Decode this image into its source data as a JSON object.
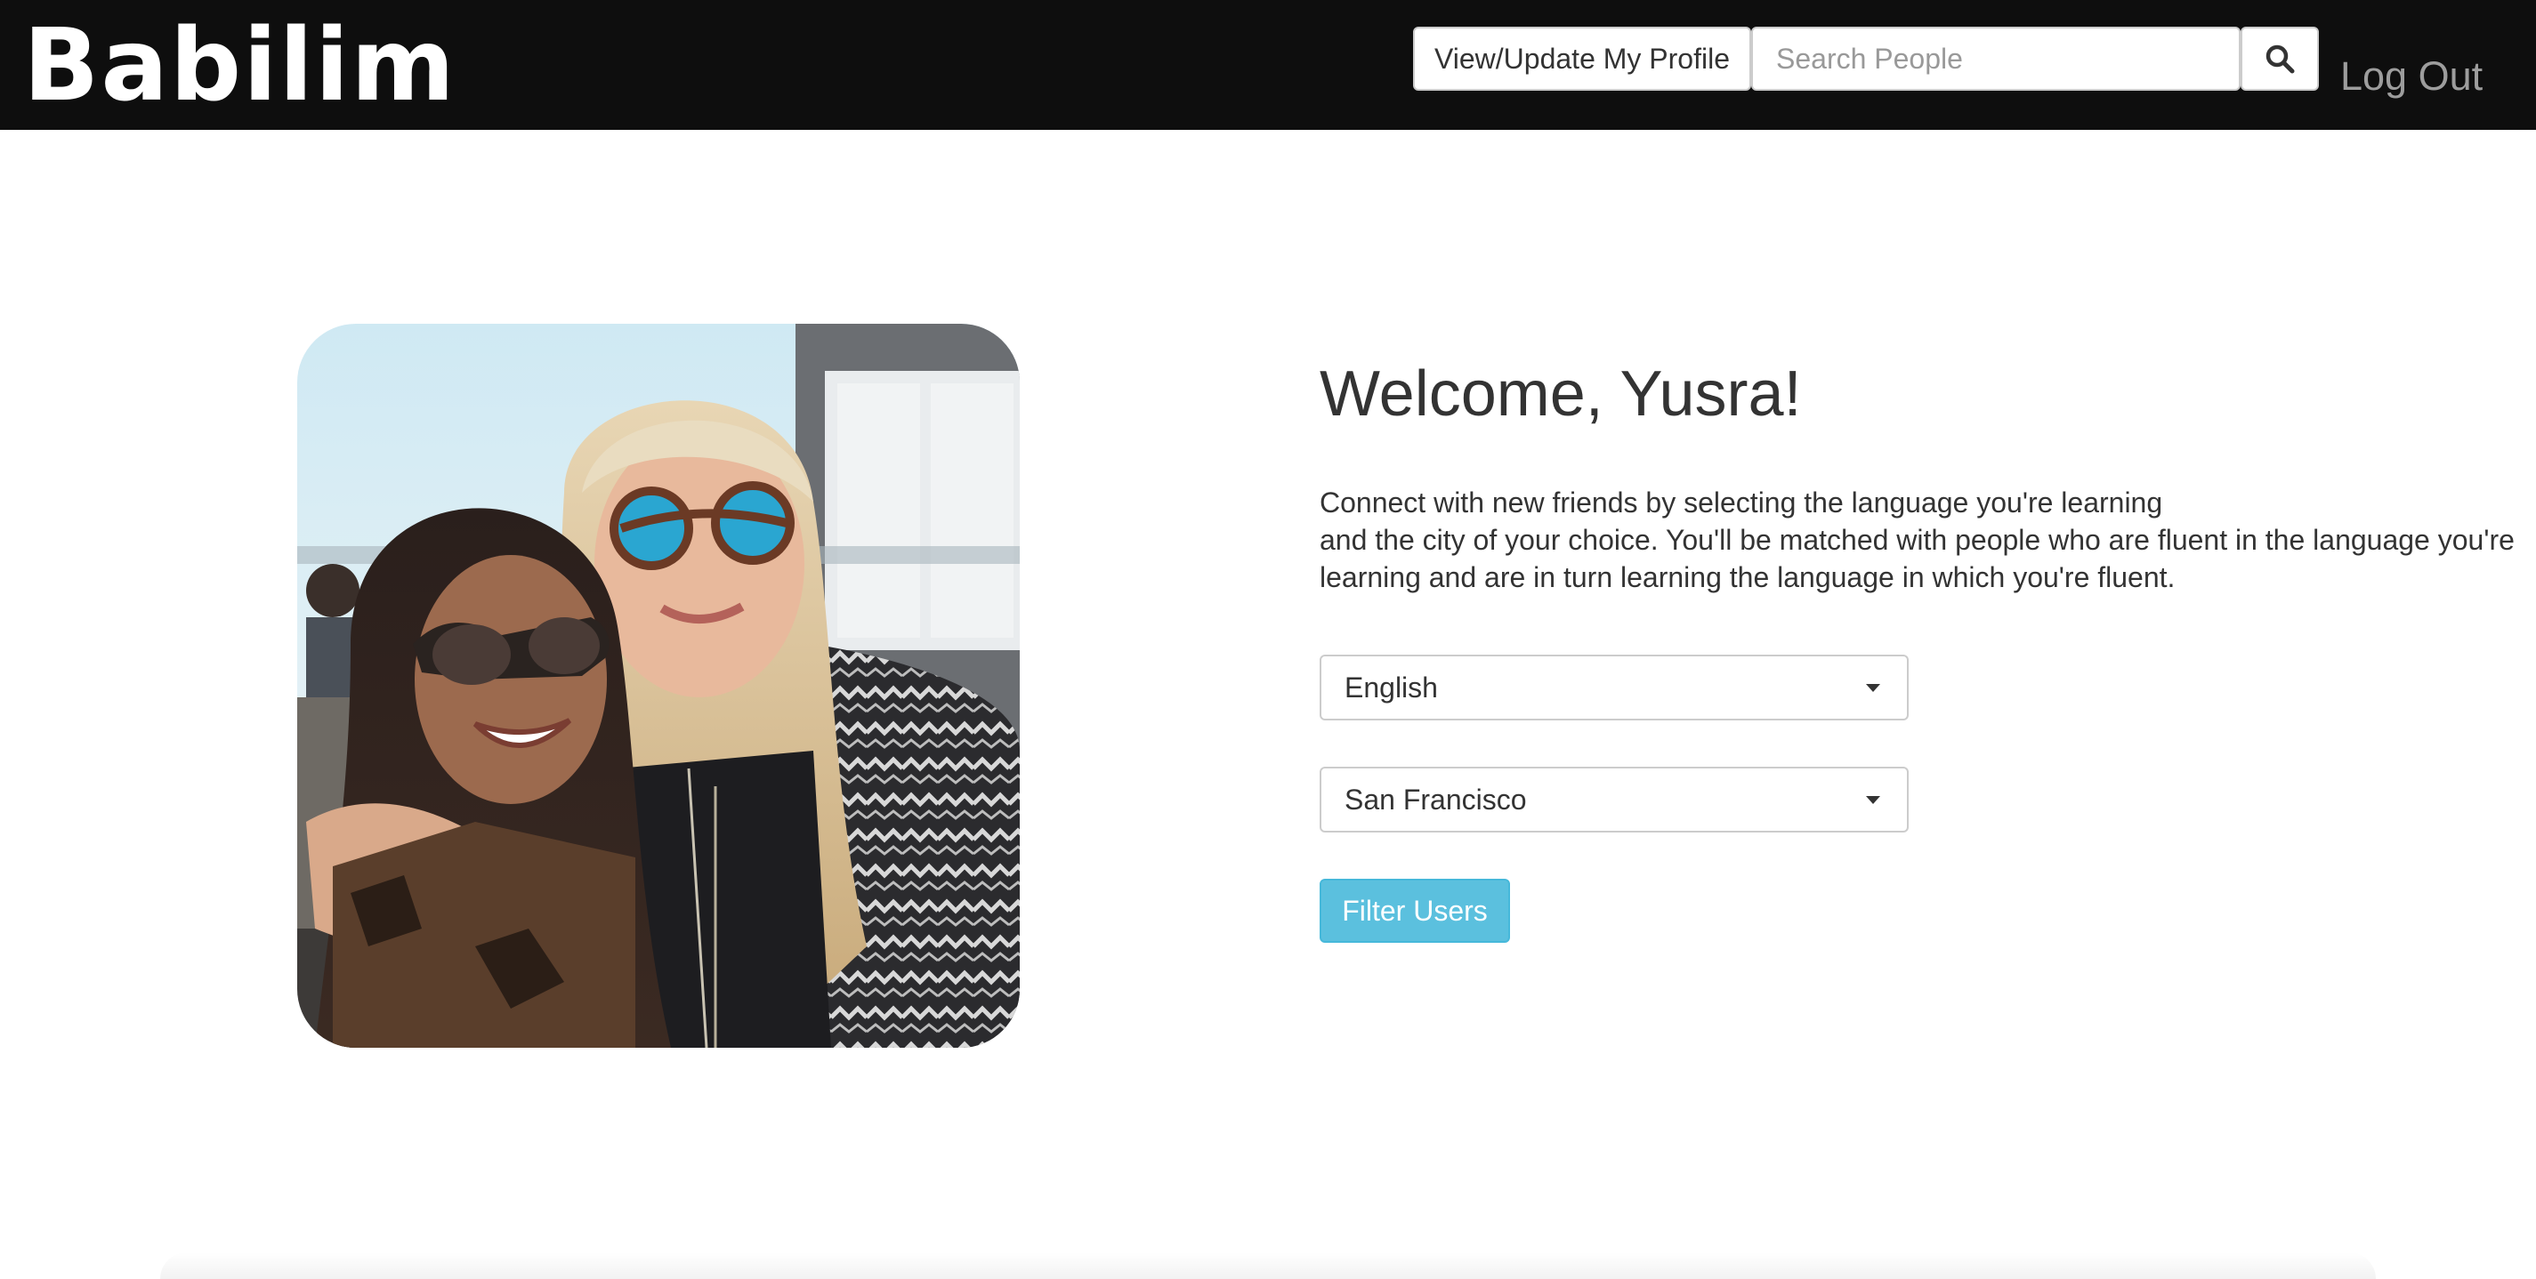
{
  "brand": {
    "name": "Babilim"
  },
  "nav": {
    "profile_button_label": "View/Update My Profile",
    "search_placeholder": "Search People",
    "search_icon": "search-icon",
    "logout_label": "Log Out"
  },
  "main": {
    "welcome_heading": "Welcome, Yusra!",
    "intro_lines": [
      "Connect with new friends by selecting the language you're learning",
      "and the city of your choice. You'll be matched with people who are fluent in the language you're",
      "learning and are in turn learning the language in which you're fluent."
    ],
    "language_select": {
      "selected": "English"
    },
    "city_select": {
      "selected": "San Francisco"
    },
    "filter_button_label": "Filter Users"
  },
  "colors": {
    "navbar_bg": "#0e0e0e",
    "brand_text": "#ffffff",
    "logout_text": "#9d9d9d",
    "filter_button_bg": "#5bc0de",
    "body_text": "#333333"
  }
}
